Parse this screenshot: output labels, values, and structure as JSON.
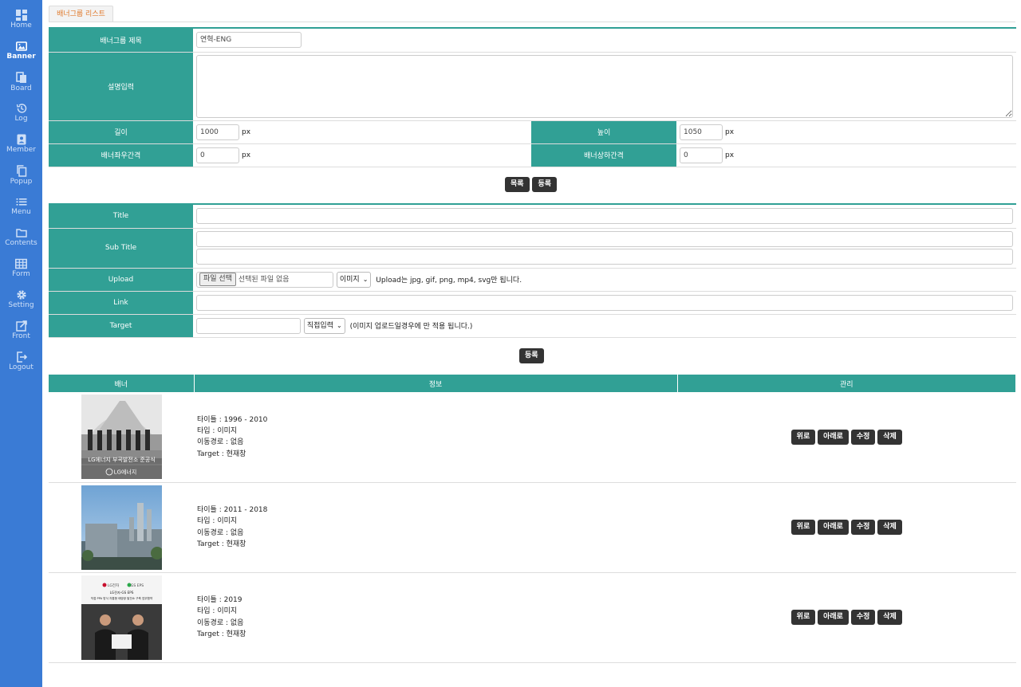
{
  "sidebar": {
    "items": [
      {
        "label": "Home",
        "icon": "dashboard-icon"
      },
      {
        "label": "Banner",
        "icon": "image-icon"
      },
      {
        "label": "Board",
        "icon": "board-icon"
      },
      {
        "label": "Log",
        "icon": "history-icon"
      },
      {
        "label": "Member",
        "icon": "member-icon"
      },
      {
        "label": "Popup",
        "icon": "copy-icon"
      },
      {
        "label": "Menu",
        "icon": "menu-list-icon"
      },
      {
        "label": "Contents",
        "icon": "folder-icon"
      },
      {
        "label": "Form",
        "icon": "table-icon"
      },
      {
        "label": "Setting",
        "icon": "gear-icon"
      },
      {
        "label": "Front",
        "icon": "external-link-icon"
      },
      {
        "label": "Logout",
        "icon": "logout-icon"
      }
    ],
    "active": "Banner",
    "color": "#3a7bd5"
  },
  "tab": {
    "label": "배너그룹 리스트"
  },
  "group_form": {
    "title_label": "배너그룹 제목",
    "title_value": "연혁-ENG",
    "desc_label": "설명입력",
    "desc_value": "",
    "width_label": "길이",
    "width_value": "1000",
    "height_label": "높이",
    "height_value": "1050",
    "hgap_label": "배너좌우간격",
    "hgap_value": "0",
    "vgap_label": "배너상하간격",
    "vgap_value": "0",
    "unit": "px",
    "list_button": "목록",
    "register_button": "등록"
  },
  "item_form": {
    "title_label": "Title",
    "title_value": "",
    "subtitle_label": "Sub Title",
    "subtitle_value1": "",
    "subtitle_value2": "",
    "upload_label": "Upload",
    "file_button": "파일 선택",
    "file_status": "선택된 파일 없음",
    "type_select": "이미지",
    "upload_hint": "Upload는 jpg, gif, png, mp4, svg만 됩니다.",
    "link_label": "Link",
    "link_value": "",
    "target_label": "Target",
    "target_value": "",
    "target_select": "직접입력",
    "target_hint": "(이미지 업로드일경우에 만 적용 됩니다.)",
    "register_button": "등록"
  },
  "list": {
    "headers": [
      "배너",
      "정보",
      "관리"
    ],
    "rows": [
      {
        "title": "타이틀 : 1996 - 2010",
        "type": "타입 : 이미지",
        "path": "이동경로 : 없음",
        "target": "Target : 현재창",
        "thumb_caption": "LG에너지 부곡발전소 준공식",
        "thumb_logo": "LG에너지"
      },
      {
        "title": "타이틀 : 2011 - 2018",
        "type": "타입 : 이미지",
        "path": "이동경로 : 없음",
        "target": "Target : 현재창"
      },
      {
        "title": "타이틀 : 2019",
        "type": "타입 : 이미지",
        "path": "이동경로 : 없음",
        "target": "Target : 현재창",
        "thumb_logo1": "LG전자",
        "thumb_logo2": "GS EPS",
        "thumb_caption1": "LG전자-GS EPS",
        "thumb_caption2": "직접 PPA 방식 자통형 태양광 발전소 구축 업무협약"
      }
    ],
    "actions": {
      "up": "위로",
      "down": "아래로",
      "edit": "수정",
      "delete": "삭제"
    }
  },
  "colors": {
    "teal": "#31a095",
    "button": "#333333",
    "tab_text": "#e07b2e"
  }
}
